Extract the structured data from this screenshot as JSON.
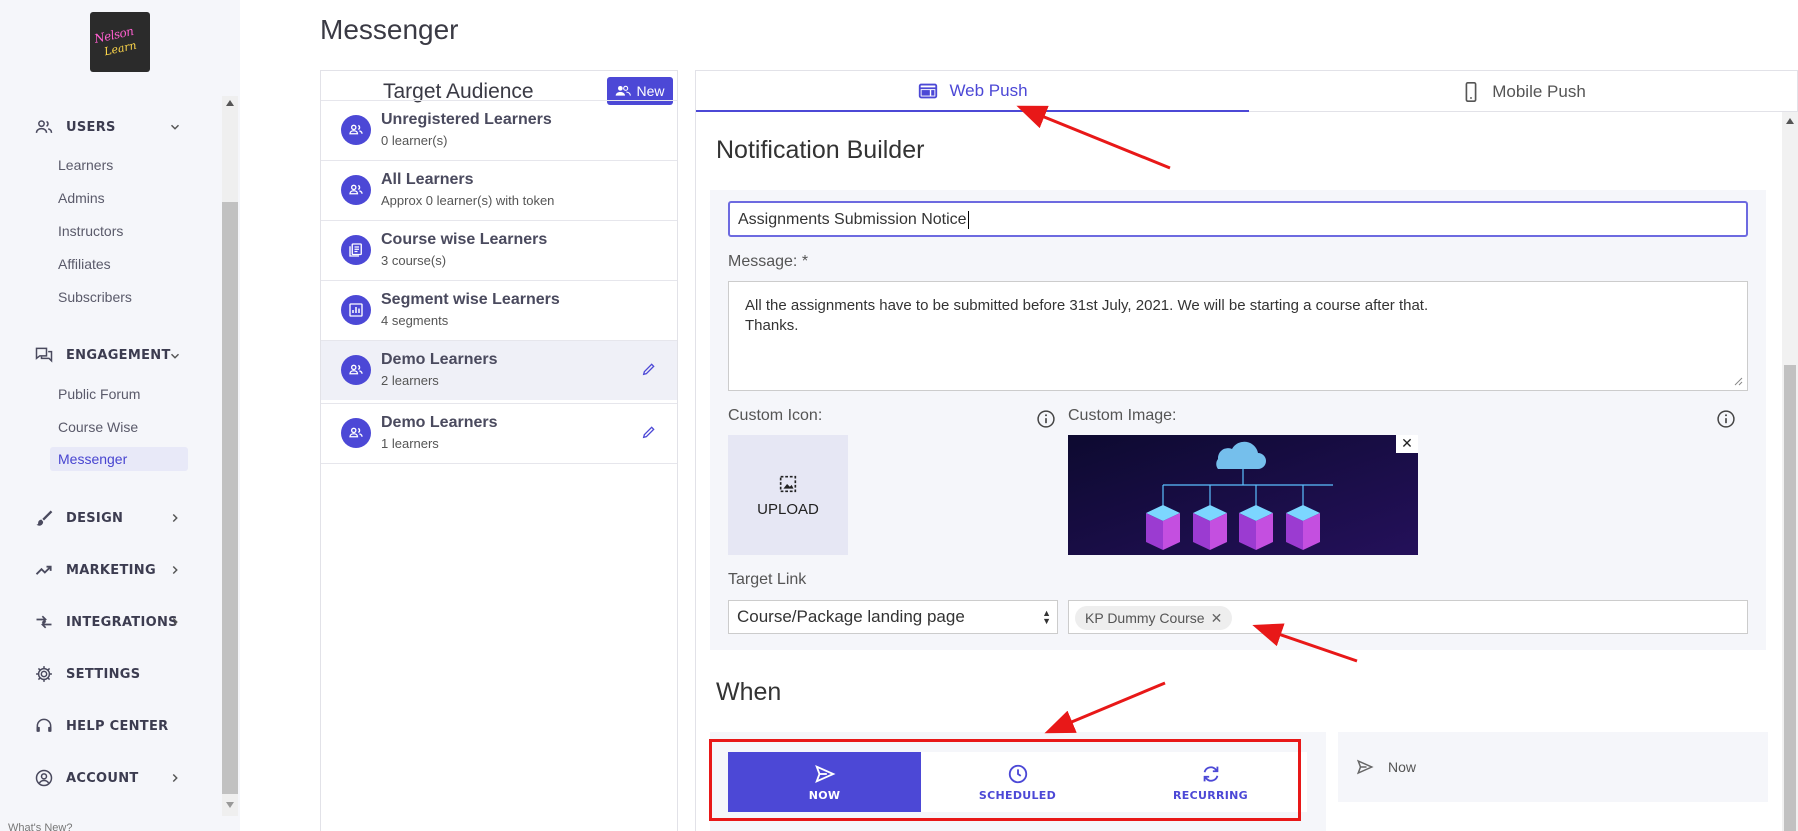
{
  "sidebar": {
    "sections": [
      {
        "label": "USERS",
        "icon": "users-icon",
        "expanded": true
      },
      {
        "label": "ENGAGEMENT",
        "icon": "forum-icon",
        "expanded": true
      },
      {
        "label": "DESIGN",
        "icon": "brush-icon",
        "expanded": false
      },
      {
        "label": "MARKETING",
        "icon": "trending-up-icon",
        "expanded": false
      },
      {
        "label": "INTEGRATIONS",
        "icon": "compare-arrows-icon",
        "expanded": false
      },
      {
        "label": "SETTINGS",
        "icon": "gear-icon",
        "expanded": false
      },
      {
        "label": "HELP CENTER",
        "icon": "headset-icon",
        "expanded": false
      },
      {
        "label": "ACCOUNT",
        "icon": "account-circle-icon",
        "expanded": false
      }
    ],
    "users_items": [
      "Learners",
      "Admins",
      "Instructors",
      "Affiliates",
      "Subscribers"
    ],
    "engagement_items": [
      "Public Forum",
      "Course Wise",
      "Messenger"
    ],
    "active_item": "Messenger",
    "bottom_text": "What's New?"
  },
  "page": {
    "title": "Messenger"
  },
  "audience": {
    "title": "Target Audience",
    "new_label": "New",
    "items": [
      {
        "name": "Unregistered Learners",
        "sub": "0 learner(s)",
        "icon": "group-icon",
        "editable": false
      },
      {
        "name": "All Learners",
        "sub": "Approx 0 learner(s) with token",
        "icon": "group-icon",
        "editable": false
      },
      {
        "name": "Course wise Learners",
        "sub": "3 course(s)",
        "icon": "library-books-icon",
        "editable": false
      },
      {
        "name": "Segment wise Learners",
        "sub": "4 segments",
        "icon": "bar-chart-icon",
        "editable": false
      },
      {
        "name": "Demo Learners",
        "sub": "2 learners",
        "icon": "group-icon",
        "editable": true,
        "selected": true
      },
      {
        "name": "Demo Learners",
        "sub": "1 learners",
        "icon": "group-icon",
        "editable": true
      }
    ]
  },
  "tabs": [
    {
      "label": "Web Push",
      "icon": "web-icon",
      "active": true
    },
    {
      "label": "Mobile Push",
      "icon": "smartphone-icon",
      "active": false
    }
  ],
  "builder": {
    "title": "Notification Builder",
    "title_value": "Assignments Submission Notice",
    "message_label": "Message: *",
    "message_line1": "All the assignments have to be submitted before 31st July, 2021. We will be starting a course after that.",
    "message_line2": "Thanks.",
    "custom_icon_label": "Custom Icon:",
    "upload_label": "UPLOAD",
    "custom_image_label": "Custom Image:",
    "target_link_label": "Target Link",
    "target_link_selected": "Course/Package landing page",
    "target_tag": "KP Dummy Course"
  },
  "when": {
    "title": "When",
    "options": [
      {
        "label": "NOW",
        "icon": "send-icon",
        "active": true
      },
      {
        "label": "SCHEDULED",
        "icon": "clock-icon",
        "active": false
      },
      {
        "label": "RECURRING",
        "icon": "sync-icon",
        "active": false
      }
    ],
    "summary": "Now"
  },
  "colors": {
    "accent": "#4c48d6",
    "annotation": "#e81818",
    "sidebar_bg": "#f5f6fa"
  }
}
